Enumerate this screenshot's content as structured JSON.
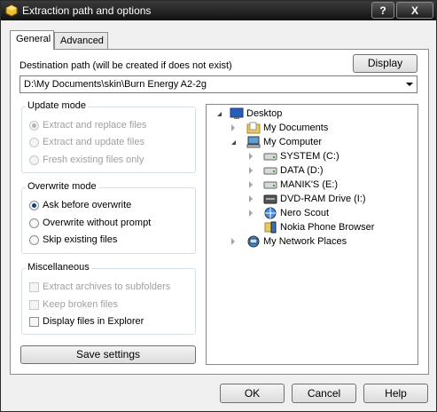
{
  "window": {
    "title": "Extraction path and options",
    "help_button": "?",
    "close_button": "X"
  },
  "tabs": [
    {
      "label": "General"
    },
    {
      "label": "Advanced"
    }
  ],
  "destination": {
    "label": "Destination path (will be created if does not exist)",
    "display_button": "Display",
    "path": "D:\\My Documents\\skin\\Burn Energy A2-2g"
  },
  "update_mode": {
    "title": "Update mode",
    "options": [
      {
        "label": "Extract and replace files",
        "selected": true,
        "enabled": false
      },
      {
        "label": "Extract and update files",
        "selected": false,
        "enabled": false
      },
      {
        "label": "Fresh existing files only",
        "selected": false,
        "enabled": false
      }
    ]
  },
  "overwrite_mode": {
    "title": "Overwrite mode",
    "options": [
      {
        "label": "Ask before overwrite",
        "selected": true,
        "enabled": true
      },
      {
        "label": "Overwrite without prompt",
        "selected": false,
        "enabled": true
      },
      {
        "label": "Skip existing files",
        "selected": false,
        "enabled": true
      }
    ]
  },
  "misc": {
    "title": "Miscellaneous",
    "options": [
      {
        "label": "Extract archives to subfolders",
        "checked": false,
        "enabled": false
      },
      {
        "label": "Keep broken files",
        "checked": false,
        "enabled": false
      },
      {
        "label": "Display files in Explorer",
        "checked": false,
        "enabled": true
      }
    ]
  },
  "save_settings_button": "Save settings",
  "tree": {
    "items": [
      {
        "label": "Desktop",
        "icon": "desktop-icon"
      },
      {
        "label": "My Documents",
        "icon": "documents-folder-icon"
      },
      {
        "label": "My Computer",
        "icon": "computer-icon"
      },
      {
        "label": "SYSTEM (C:)",
        "icon": "hard-drive-icon"
      },
      {
        "label": "DATA (D:)",
        "icon": "hard-drive-icon"
      },
      {
        "label": "MANIK'S (E:)",
        "icon": "hard-drive-icon"
      },
      {
        "label": "DVD-RAM Drive (I:)",
        "icon": "dvd-drive-icon"
      },
      {
        "label": "Nero Scout",
        "icon": "nero-scout-icon"
      },
      {
        "label": "Nokia Phone Browser",
        "icon": "nokia-phone-icon"
      },
      {
        "label": "My Network Places",
        "icon": "network-places-icon"
      }
    ]
  },
  "buttons": {
    "ok": "OK",
    "cancel": "Cancel",
    "help": "Help"
  }
}
